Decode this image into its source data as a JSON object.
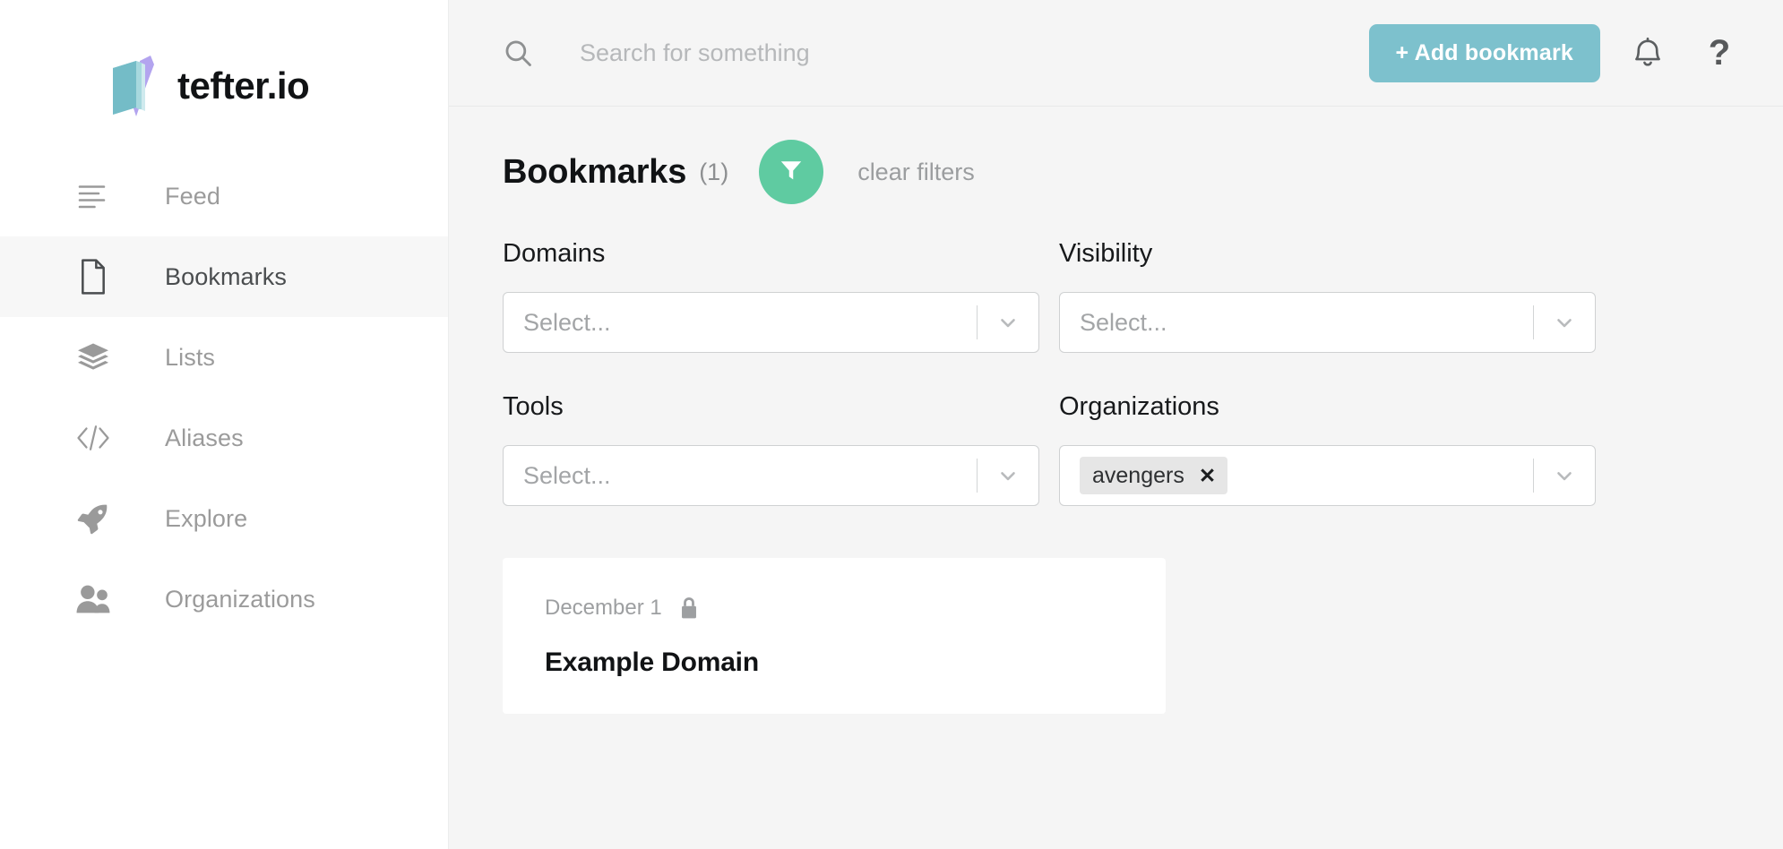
{
  "brand": {
    "name": "tefter.io",
    "logo_icon": "notebook-pen-logo",
    "logo_book_color": "#74bcc7",
    "logo_pen_color": "#b3a4ef"
  },
  "sidebar": {
    "items": [
      {
        "label": "Feed",
        "icon": "feed-lines-icon",
        "active": false
      },
      {
        "label": "Bookmarks",
        "icon": "document-icon",
        "active": true
      },
      {
        "label": "Lists",
        "icon": "layers-icon",
        "active": false
      },
      {
        "label": "Aliases",
        "icon": "code-brackets-icon",
        "active": false
      },
      {
        "label": "Explore",
        "icon": "rocket-icon",
        "active": false
      },
      {
        "label": "Organizations",
        "icon": "people-icon",
        "active": false
      }
    ]
  },
  "topbar": {
    "search": {
      "icon": "search-icon",
      "placeholder": "Search for something",
      "value": ""
    },
    "add_bookmark_label": "+ Add bookmark",
    "add_bookmark_color": "#7dc1cd",
    "notifications_icon": "bell-icon",
    "help_icon": "question-mark-icon",
    "help_label": "?"
  },
  "page": {
    "title": "Bookmarks",
    "count": "(1)",
    "filter_icon": "funnel-icon",
    "filter_circle_color": "#5fcba1",
    "clear_filters_label": "clear filters"
  },
  "filters": [
    {
      "label": "Domains",
      "placeholder": "Select...",
      "tags": []
    },
    {
      "label": "Visibility",
      "placeholder": "Select...",
      "tags": []
    },
    {
      "label": "Tools",
      "placeholder": "Select...",
      "tags": []
    },
    {
      "label": "Organizations",
      "placeholder": "",
      "tags": [
        {
          "label": "avengers",
          "remove": "✕"
        }
      ]
    }
  ],
  "bookmarks": [
    {
      "date": "December 1",
      "visibility_icon": "lock-icon",
      "title": "Example Domain"
    }
  ]
}
